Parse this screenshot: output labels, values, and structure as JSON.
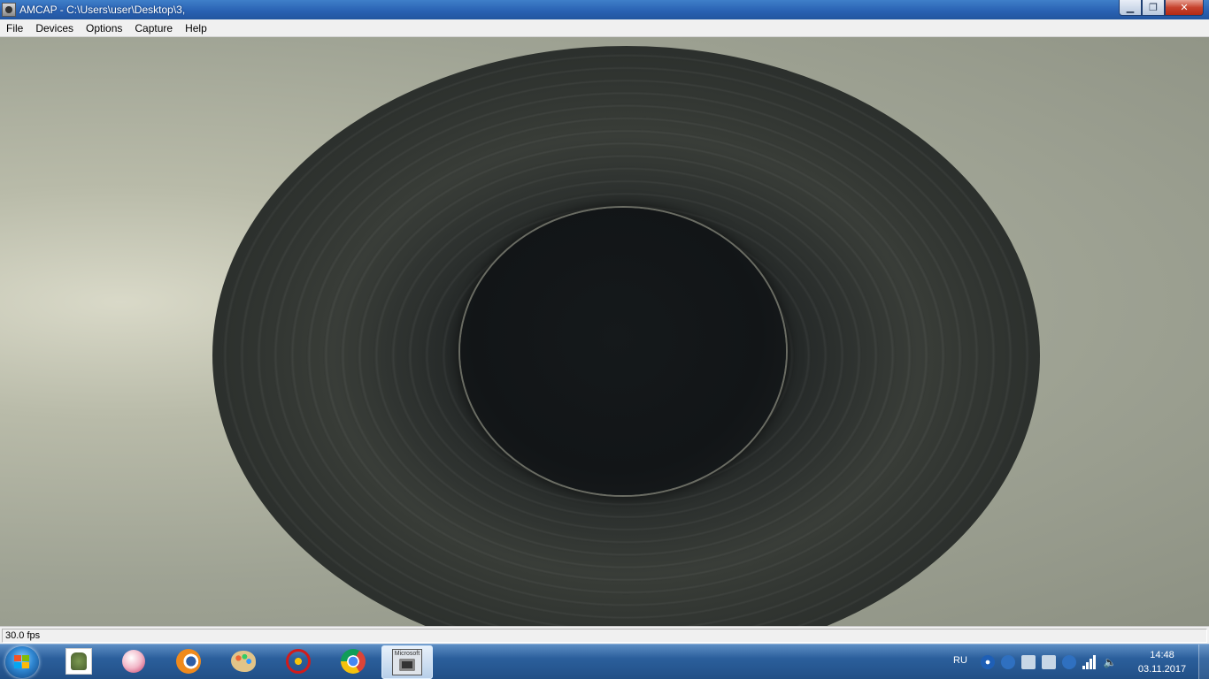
{
  "window": {
    "title": "AMCAP - C:\\Users\\user\\Desktop\\3,",
    "min_symbol": "▁",
    "max_symbol": "❐",
    "close_symbol": "✕"
  },
  "menu": {
    "items": [
      "File",
      "Devices",
      "Options",
      "Capture",
      "Help"
    ]
  },
  "status": {
    "fps": "30.0 fps"
  },
  "taskbar": {
    "icons": [
      "pcb-app-icon",
      "balloon-app-icon",
      "blender-icon",
      "paint-palette-icon",
      "kompas-icon",
      "chrome-icon",
      "amcap-icon"
    ],
    "active_app": "amcap",
    "amcap_label": "Microsoft",
    "language": "RU",
    "clock_time": "14:48",
    "clock_date": "03.11.2017"
  },
  "colors": {
    "titlebar": "#2a62b3",
    "taskbar": "#2b5f9c",
    "close_button": "#c6432e"
  }
}
